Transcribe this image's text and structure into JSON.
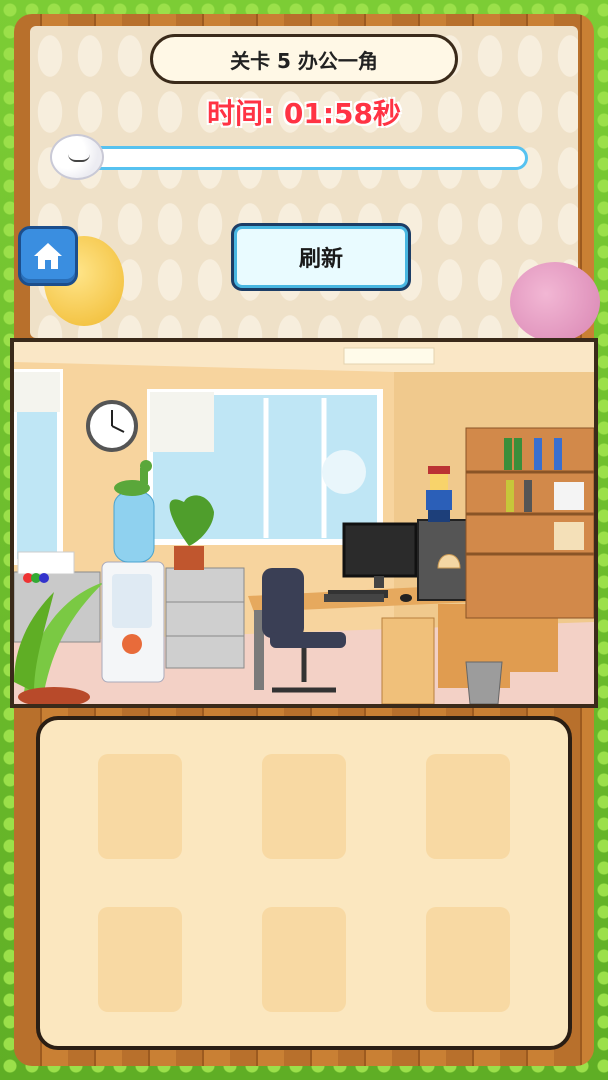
{
  "level": {
    "title": "关卡 5 办公一角"
  },
  "timer": {
    "text": "时间: 01:58秒"
  },
  "progress": {
    "fraction": 0.0
  },
  "buttons": {
    "home_icon": "home-icon",
    "refresh_label": "刷新"
  },
  "scene": {
    "objects": [
      "wall-clock",
      "water-dispenser",
      "dinosaur-toy",
      "potted-plant",
      "office-chair",
      "desk",
      "computer-monitor",
      "computer-tower",
      "lego-figure",
      "seashell",
      "bookshelf",
      "filing-cabinet",
      "trash-bin",
      "keyboard",
      "mouse"
    ]
  },
  "inventory": {
    "slots": [
      "",
      "",
      "",
      "",
      "",
      ""
    ]
  },
  "colors": {
    "timer": "#ff3344",
    "accent_blue": "#49b7e2",
    "frame_green": "#6fbf2f",
    "inventory_bg": "#fbe7bf"
  }
}
